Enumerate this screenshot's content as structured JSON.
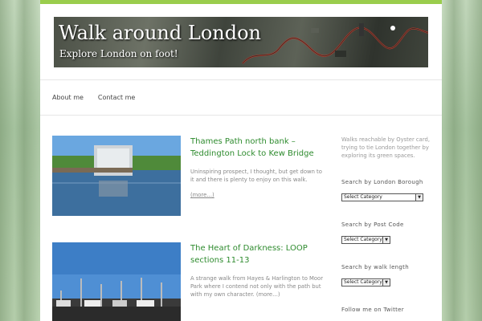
{
  "site": {
    "title": "Walk around London",
    "tagline": "Explore London on foot!"
  },
  "nav": {
    "items": [
      {
        "label": "About me"
      },
      {
        "label": "Contact me"
      }
    ]
  },
  "posts": [
    {
      "title": "Thames Path north bank – Teddington Lock to Kew Bridge",
      "excerpt": "Uninspiring prospect, I thought, but get down to it and there is plenty to enjoy on this walk.",
      "more": "(more…)"
    },
    {
      "title": "The Heart of Darkness: LOOP sections 11-13",
      "excerpt": "A strange walk from Hayes & Harlington to Moor Park where I contend not only with the path but with my own character.",
      "more": "(more…)"
    }
  ],
  "sidebar": {
    "intro": "Walks reachable by Oyster card, trying to tie London together by exploring its green spaces.",
    "borough_heading": "Search by London Borough",
    "borough_select": "Select Category",
    "postcode_heading": "Search by Post Code",
    "postcode_select": "Select Category",
    "length_heading": "Search by walk length",
    "length_select": "Select Category",
    "twitter_heading": "Follow me on Twitter"
  },
  "colors": {
    "accent": "#9acd4c",
    "link": "#2e8b2e"
  }
}
